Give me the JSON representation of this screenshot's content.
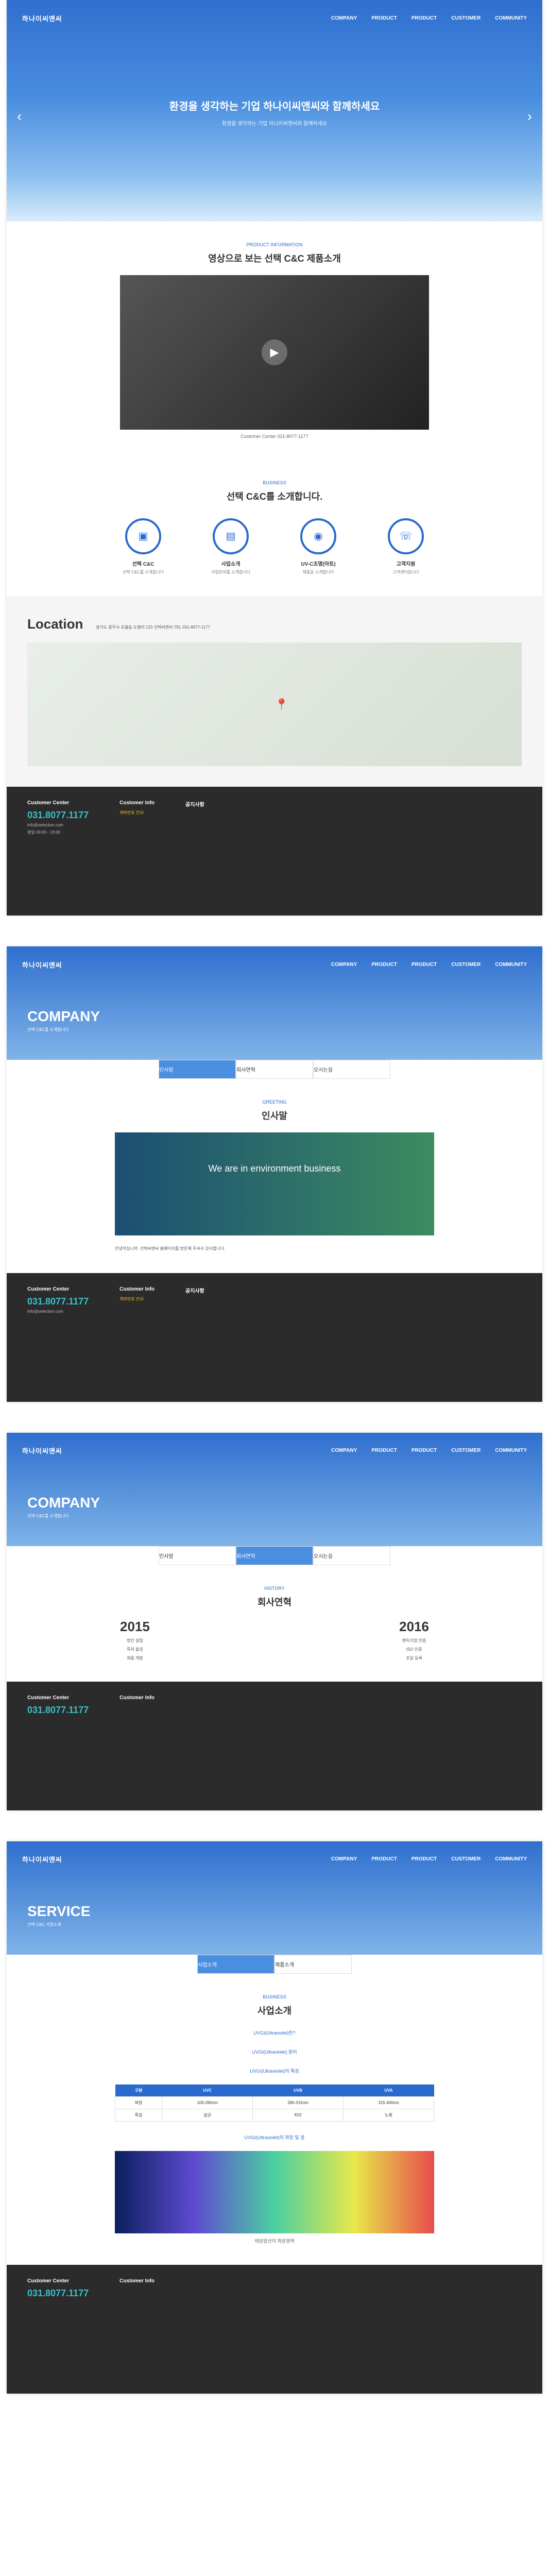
{
  "nav": {
    "logo": "하나이씨앤씨",
    "items": [
      "COMPANY",
      "PRODUCT",
      "PRODUCT",
      "CUSTOMER",
      "COMMUNITY"
    ]
  },
  "hero": {
    "title": "환경을 생각하는 기업 하나이씨앤씨와 함께하세요",
    "subtitle": "환경을 생각하는 기업 하나이씨앤씨와 함께하세요"
  },
  "video": {
    "small": "PRODUCT INFORMATION",
    "title": "영상으로 보는 선택 C&C 제품소개",
    "caption": "Customer Center 031-8077-1177"
  },
  "intro": {
    "small": "BUSINESS",
    "title": "선택 C&C를 소개합니다.",
    "cards": [
      {
        "label": "선택 C&C",
        "desc": "선택 C&C를 소개합니다"
      },
      {
        "label": "사업소개",
        "desc": "사업분야를 소개합니다"
      },
      {
        "label": "UV-C조명(아트)",
        "desc": "제품을 소개합니다"
      },
      {
        "label": "고객지원",
        "desc": "고객센터입니다"
      }
    ]
  },
  "location": {
    "title": "Location",
    "address": "경기도 광주시 초월읍 도평리 123 선택씨앤씨 TEL 031-8077-1177"
  },
  "footer": {
    "cc_title": "Customer Center",
    "phone": "031.8077.1177",
    "email": "info@selection.com",
    "hours": "평일 09:00 - 18:00",
    "bank_title": "Customer Info",
    "bank_line": "계좌번호 안내",
    "notice_title": "공지사항"
  },
  "company1": {
    "hero_title": "COMPANY",
    "hero_desc": "선택 C&C를 소개합니다",
    "tabs": [
      "인사말",
      "회사연혁",
      "오시는길"
    ],
    "small": "GREETING",
    "title": "인사말",
    "banner": "We are in environment business",
    "para": "안녕하십니까. 선택씨앤씨 홈페이지를 방문해 주셔서 감사합니다."
  },
  "company2": {
    "hero_title": "COMPANY",
    "hero_desc": "선택 C&C를 소개합니다",
    "tabs": [
      "인사말",
      "회사연혁",
      "오시는길"
    ],
    "small": "HISTORY",
    "title": "회사연혁",
    "year1": "2015",
    "year2": "2016",
    "items1": [
      "법인 설립",
      "특허 출원",
      "제품 개발"
    ],
    "items2": [
      "벤처기업 인증",
      "ISO 인증",
      "조달 등록"
    ]
  },
  "service": {
    "hero_title": "SERVICE",
    "hero_desc": "선택 C&C 사업소개",
    "tabs": [
      "사업소개",
      "제품소개"
    ],
    "small": "BUSINESS",
    "title": "사업소개",
    "section1": "UVGI(Ultraviolet)란?",
    "section2": "UVGI(Ultraviolet) 원리",
    "section3": "UVGI(Ultraviolet)의 특징",
    "table_head": [
      "구분",
      "UVC",
      "UVB",
      "UVA"
    ],
    "table_rows": [
      [
        "파장",
        "100-280nm",
        "280-315nm",
        "315-400nm"
      ],
      [
        "특징",
        "살균",
        "피부",
        "노화"
      ]
    ],
    "section4": "UVGI(Ultraviolet)의 파장 및 광",
    "caption": "태양광선의 파장영역"
  }
}
